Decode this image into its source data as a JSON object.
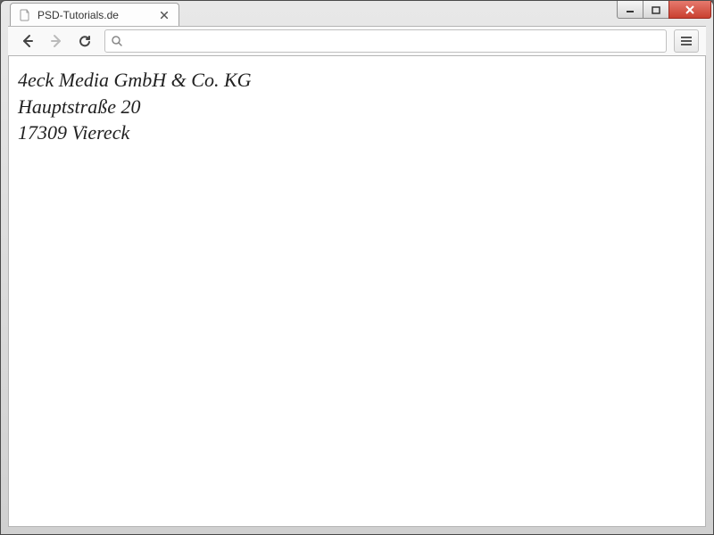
{
  "window": {
    "tab_title": "PSD-Tutorials.de"
  },
  "toolbar": {
    "url_value": ""
  },
  "page": {
    "company_name": "4eck Media GmbH & Co. KG",
    "street": "Hauptstraße 20",
    "postal_city": "17309 Viereck"
  }
}
